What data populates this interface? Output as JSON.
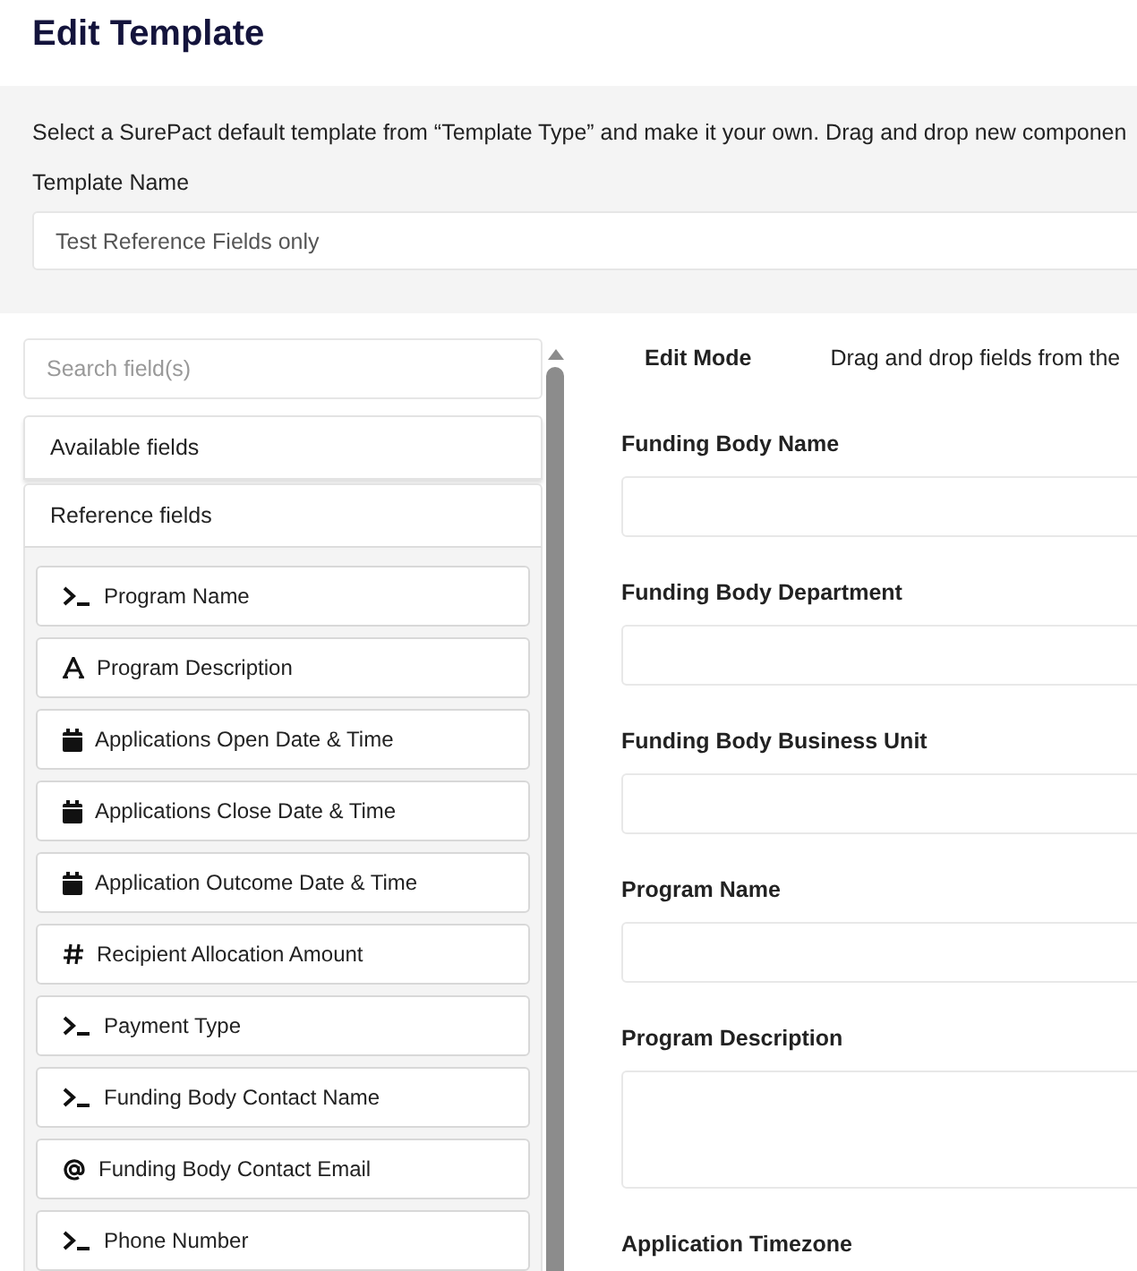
{
  "page": {
    "title": "Edit Template"
  },
  "template": {
    "instructions": "Select a SurePact default template from “Template Type” and make it your own. Drag and drop new componen",
    "name_label": "Template Name",
    "name_value": "Test Reference Fields only"
  },
  "palette": {
    "search": {
      "placeholder": "Search field(s)"
    },
    "sections": [
      {
        "label": "Available fields",
        "expanded": false
      },
      {
        "label": "Reference fields",
        "expanded": true,
        "items": [
          {
            "kind": "text",
            "label": "Program Name"
          },
          {
            "kind": "textarea",
            "label": "Program Description"
          },
          {
            "kind": "date",
            "label": "Applications Open Date & Time"
          },
          {
            "kind": "date",
            "label": "Applications Close Date & Time"
          },
          {
            "kind": "date",
            "label": "Application Outcome Date & Time"
          },
          {
            "kind": "number",
            "label": "Recipient Allocation Amount"
          },
          {
            "kind": "text",
            "label": "Payment Type"
          },
          {
            "kind": "text",
            "label": "Funding Body Contact Name"
          },
          {
            "kind": "email",
            "label": "Funding Body Contact Email"
          },
          {
            "kind": "text",
            "label": "Phone Number"
          }
        ]
      }
    ]
  },
  "editor": {
    "mode": "Edit Mode",
    "hint": "Drag and drop fields from the",
    "fields": [
      {
        "label": "Funding Body Name",
        "kind": "input"
      },
      {
        "label": "Funding Body Department",
        "kind": "input"
      },
      {
        "label": "Funding Body Business Unit",
        "kind": "input"
      },
      {
        "label": "Program Name",
        "kind": "input"
      },
      {
        "label": "Program Description",
        "kind": "textarea"
      },
      {
        "label": "Application Timezone",
        "kind": "offscreen"
      }
    ]
  }
}
